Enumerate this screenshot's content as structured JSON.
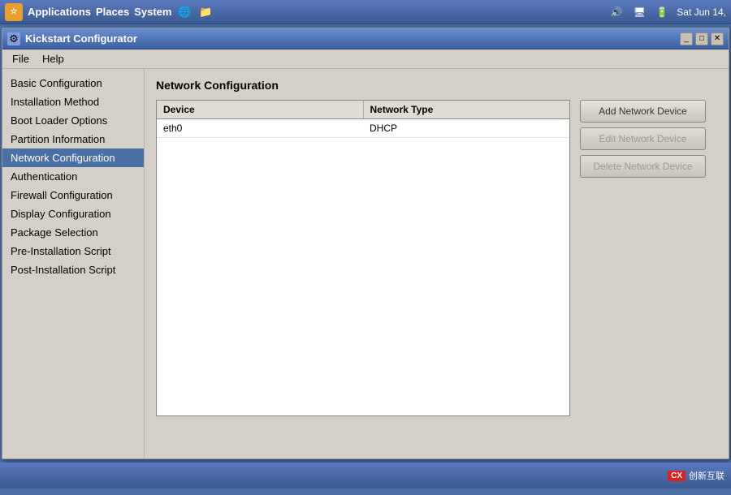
{
  "taskbar": {
    "apps_label": "Applications",
    "places_label": "Places",
    "system_label": "System",
    "datetime": "Sat Jun 14,",
    "app_icon_text": "☆"
  },
  "window": {
    "title": "Kickstart Configurator",
    "icon_text": "⚙"
  },
  "menubar": {
    "file_label": "File",
    "help_label": "Help"
  },
  "sidebar": {
    "items": [
      {
        "label": "Basic Configuration",
        "id": "basic-configuration"
      },
      {
        "label": "Installation Method",
        "id": "installation-method"
      },
      {
        "label": "Boot Loader Options",
        "id": "boot-loader-options"
      },
      {
        "label": "Partition Information",
        "id": "partition-information"
      },
      {
        "label": "Network Configuration",
        "id": "network-configuration"
      },
      {
        "label": "Authentication",
        "id": "authentication"
      },
      {
        "label": "Firewall Configuration",
        "id": "firewall-configuration"
      },
      {
        "label": "Display Configuration",
        "id": "display-configuration"
      },
      {
        "label": "Package Selection",
        "id": "package-selection"
      },
      {
        "label": "Pre-Installation Script",
        "id": "pre-installation-script"
      },
      {
        "label": "Post-Installation Script",
        "id": "post-installation-script"
      }
    ]
  },
  "content": {
    "section_title": "Network Configuration",
    "table": {
      "columns": [
        "Device",
        "Network Type"
      ],
      "rows": [
        {
          "device": "eth0",
          "type": "DHCP"
        }
      ]
    },
    "buttons": {
      "add": "Add Network Device",
      "edit": "Edit Network Device",
      "delete": "Delete Network Device"
    }
  },
  "bottom": {
    "logo_text": "创新互联",
    "logo_box": "CX"
  }
}
